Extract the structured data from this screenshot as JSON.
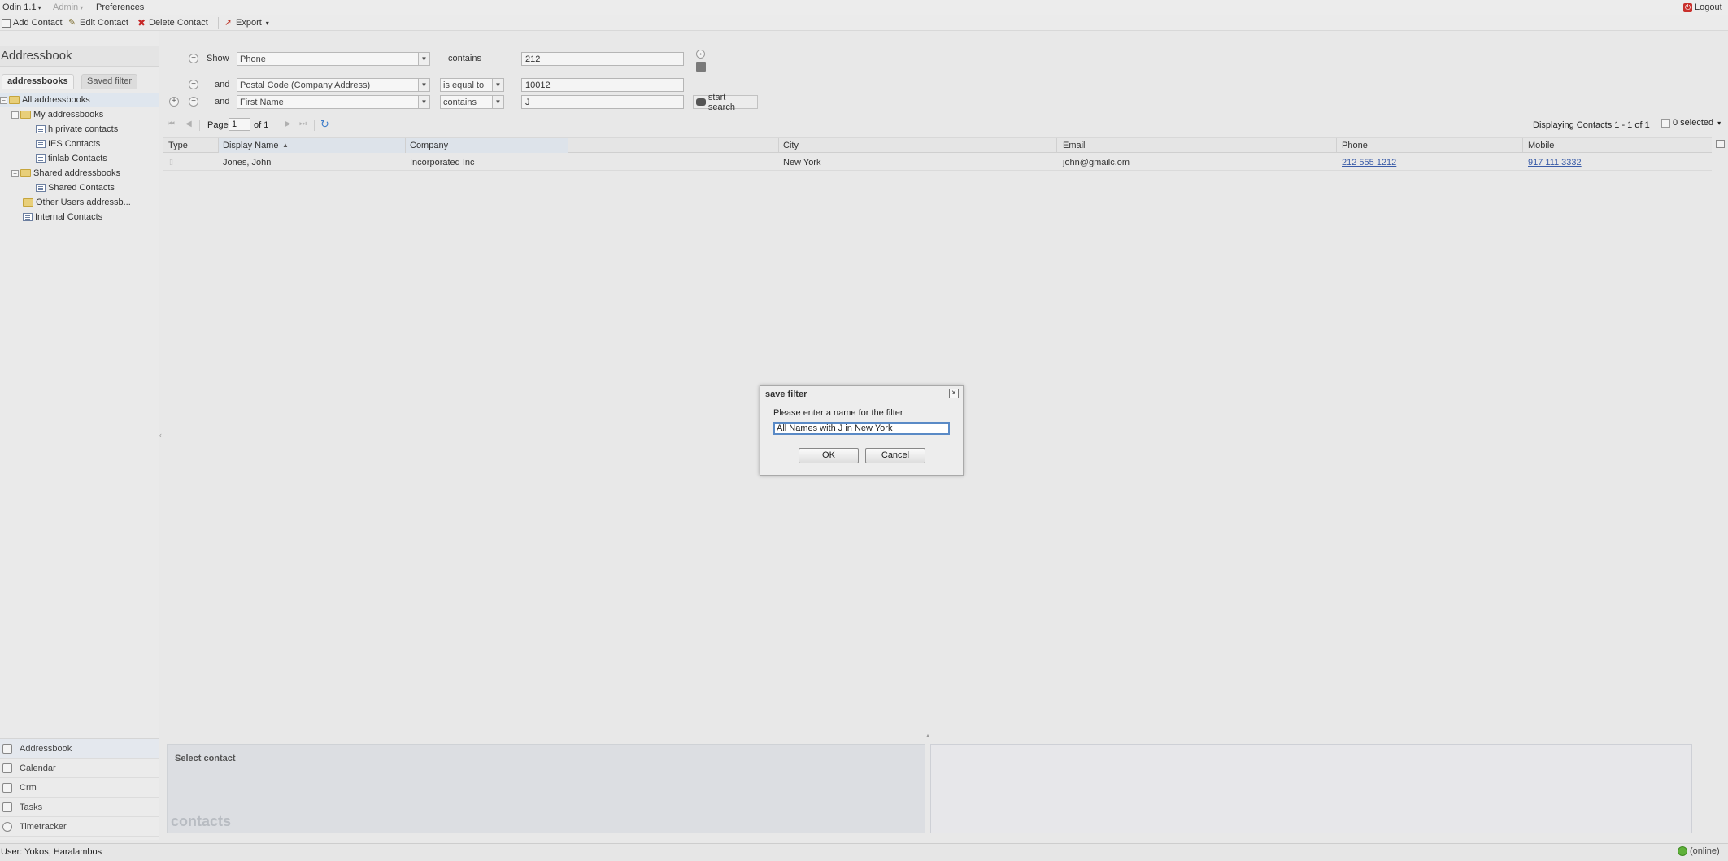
{
  "menubar": {
    "app": "Odin 1.1",
    "admin": "Admin",
    "preferences": "Preferences",
    "logout": "Logout"
  },
  "toolbar": {
    "add": "Add Contact",
    "edit": "Edit Contact",
    "delete": "Delete Contact",
    "export": "Export"
  },
  "sidebar": {
    "title": "Addressbook",
    "tabs": [
      "addressbooks",
      "Saved filter"
    ],
    "tree": [
      "All addressbooks",
      "My addressbooks",
      "h private contacts",
      "IES Contacts",
      "tinlab Contacts",
      "Shared addressbooks",
      "Shared Contacts",
      "Other Users addressb...",
      "Internal Contacts"
    ]
  },
  "filter": {
    "rows": [
      {
        "conj": "Show",
        "field": "Phone",
        "operator": "contains",
        "value": "212"
      },
      {
        "conj": "and",
        "field": "Postal Code (Company Address)",
        "operator": "is equal to",
        "value": "10012"
      },
      {
        "conj": "and",
        "field": "First Name",
        "operator": "contains",
        "value": "J"
      }
    ],
    "search_button": "start search"
  },
  "pager": {
    "page_label": "Page",
    "page": "1",
    "of": "of 1",
    "displaying": "Displaying Contacts 1 - 1 of 1",
    "selected": "0 selected"
  },
  "grid": {
    "columns": [
      "Type",
      "Display Name",
      "Company",
      "City",
      "Email",
      "Phone",
      "Mobile"
    ],
    "rows": [
      {
        "name": "Jones, John",
        "company": "Incorporated Inc",
        "city": "New York",
        "email": "john@gmailc.om",
        "phone": "212 555 1212",
        "mobile": "917 111 3332"
      }
    ]
  },
  "dialog": {
    "title": "save filter",
    "prompt": "Please enter a name for the filter",
    "value": "All Names with J in New York",
    "ok": "OK",
    "cancel": "Cancel"
  },
  "apps": [
    "Addressbook",
    "Calendar",
    "Crm",
    "Tasks",
    "Timetracker"
  ],
  "detail": {
    "select": "Select contact",
    "watermark": "contacts"
  },
  "status": {
    "user": "User: Yokos, Haralambos",
    "online": "(online)"
  }
}
